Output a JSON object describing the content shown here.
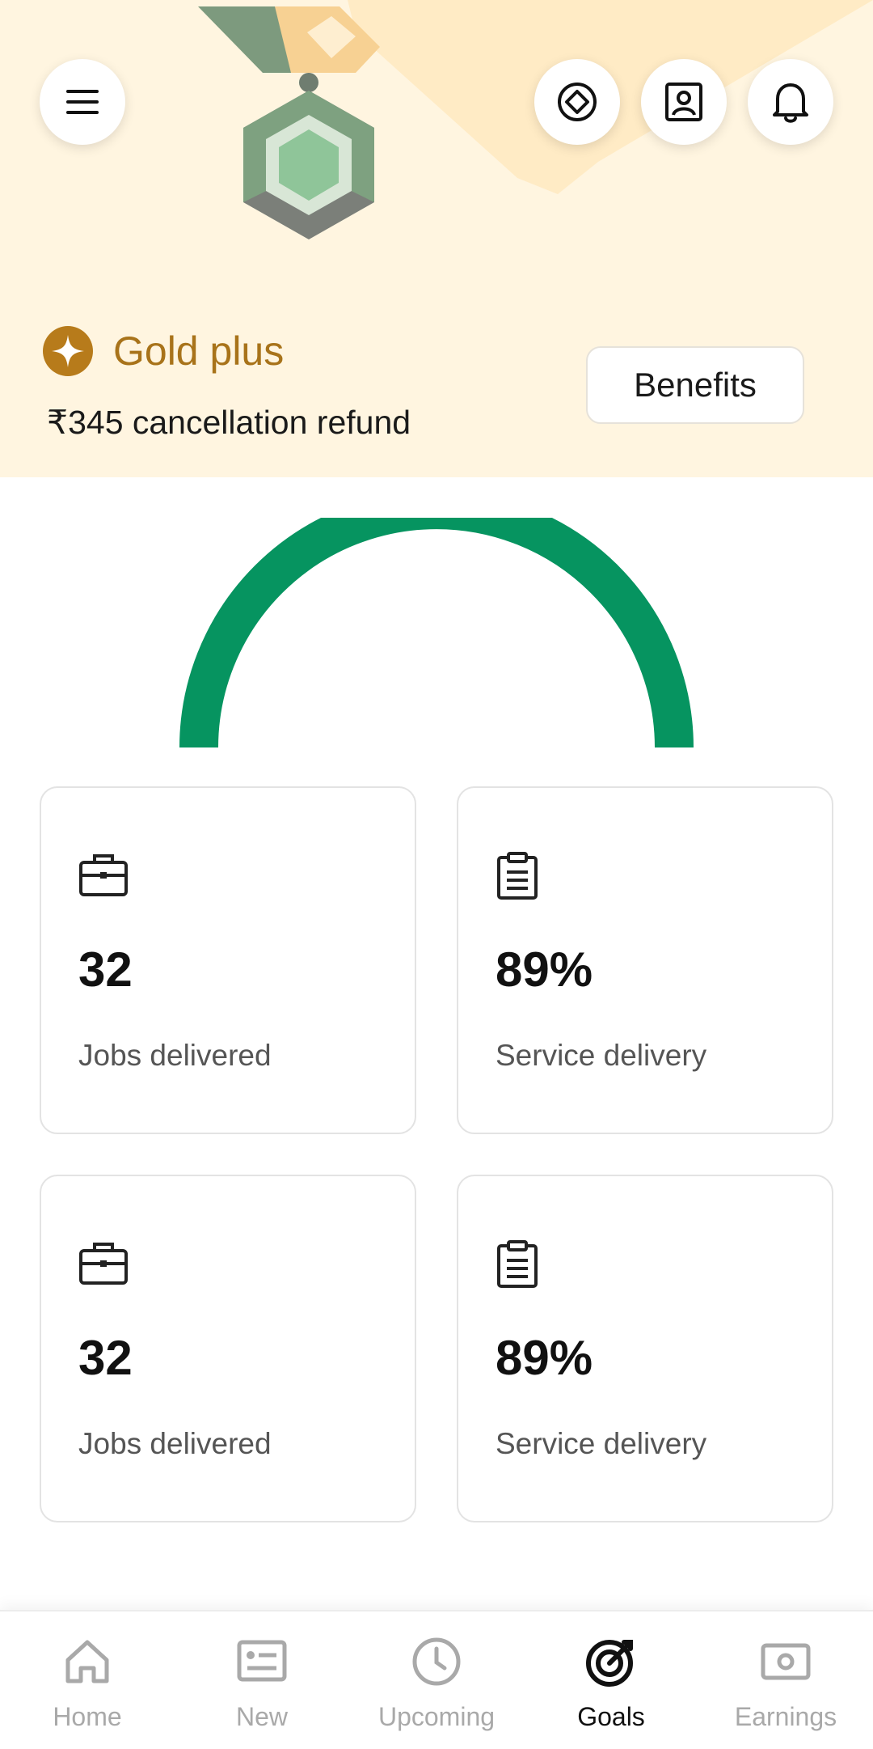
{
  "header": {
    "menu_icon": "hamburger-menu-icon",
    "action_icons": [
      "badge-diamond-icon",
      "profile-card-icon",
      "bell-icon"
    ],
    "medal_icon": "hexagon-medal-icon"
  },
  "tier": {
    "icon": "gold-star-badge-icon",
    "name": "Gold plus",
    "refund_text": "₹345 cancellation refund",
    "benefits_label": "Benefits",
    "colors": {
      "background": "#fff5e0",
      "tier_text": "#a8731a",
      "badge": "#b77b1b"
    }
  },
  "gauge": {
    "color": "#069460",
    "fill_fraction": 1.0
  },
  "stats": [
    {
      "icon": "briefcase-icon",
      "value": "32",
      "label": "Jobs delivered"
    },
    {
      "icon": "clipboard-icon",
      "value": "89%",
      "label": "Service delivery"
    },
    {
      "icon": "briefcase-icon",
      "value": "32",
      "label": "Jobs delivered"
    },
    {
      "icon": "clipboard-icon",
      "value": "89%",
      "label": "Service delivery"
    }
  ],
  "bottom_nav": {
    "items": [
      {
        "label": "Home",
        "icon": "home-icon",
        "active": false
      },
      {
        "label": "New",
        "icon": "new-list-icon",
        "active": false
      },
      {
        "label": "Upcoming",
        "icon": "clock-icon",
        "active": false
      },
      {
        "label": "Goals",
        "icon": "target-icon",
        "active": true
      },
      {
        "label": "Earnings",
        "icon": "cash-icon",
        "active": false
      }
    ]
  }
}
